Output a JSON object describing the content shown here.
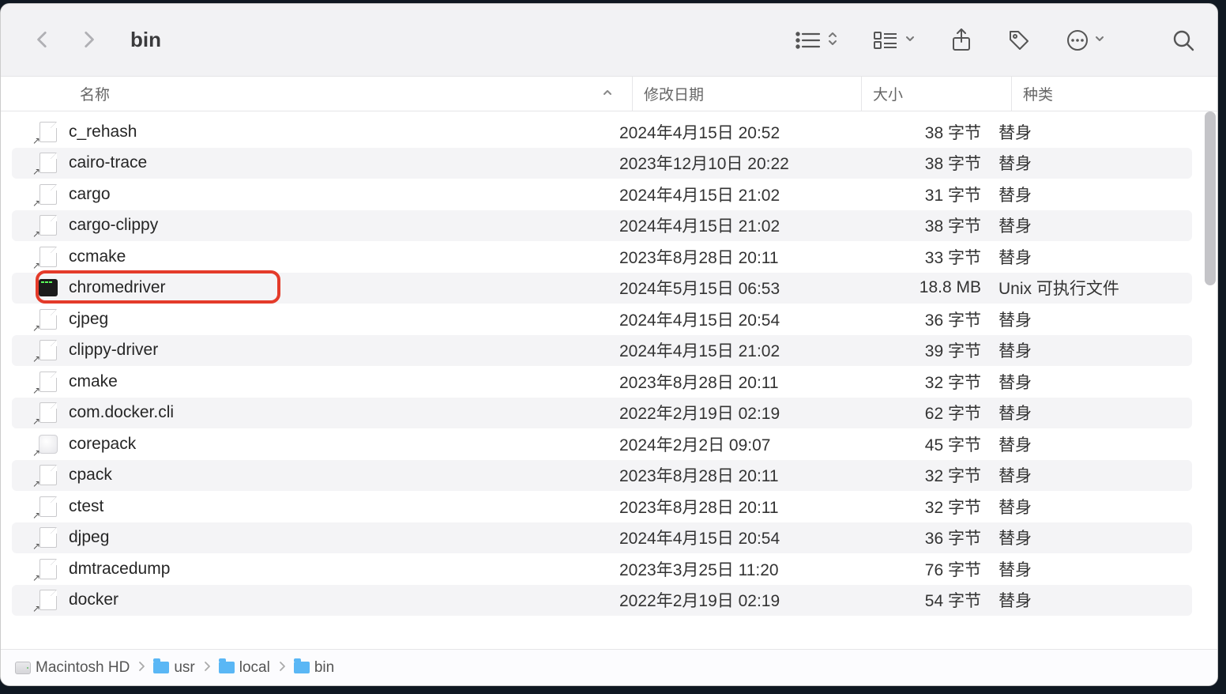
{
  "toolbar": {
    "title": "bin"
  },
  "columns": {
    "name": "名称",
    "date": "修改日期",
    "size": "大小",
    "kind": "种类"
  },
  "files": [
    {
      "name": "c_rehash",
      "date": "2024年4月15日 20:52",
      "size": "38 字节",
      "kind": "替身",
      "icon": "alias"
    },
    {
      "name": "cairo-trace",
      "date": "2023年12月10日 20:22",
      "size": "38 字节",
      "kind": "替身",
      "icon": "alias"
    },
    {
      "name": "cargo",
      "date": "2024年4月15日 21:02",
      "size": "31 字节",
      "kind": "替身",
      "icon": "alias"
    },
    {
      "name": "cargo-clippy",
      "date": "2024年4月15日 21:02",
      "size": "38 字节",
      "kind": "替身",
      "icon": "alias"
    },
    {
      "name": "ccmake",
      "date": "2023年8月28日 20:11",
      "size": "33 字节",
      "kind": "替身",
      "icon": "alias"
    },
    {
      "name": "chromedriver",
      "date": "2024年5月15日 06:53",
      "size": "18.8 MB",
      "kind": "Unix 可执行文件",
      "icon": "exec",
      "highlighted": true
    },
    {
      "name": "cjpeg",
      "date": "2024年4月15日 20:54",
      "size": "36 字节",
      "kind": "替身",
      "icon": "alias"
    },
    {
      "name": "clippy-driver",
      "date": "2024年4月15日 21:02",
      "size": "39 字节",
      "kind": "替身",
      "icon": "alias"
    },
    {
      "name": "cmake",
      "date": "2023年8月28日 20:11",
      "size": "32 字节",
      "kind": "替身",
      "icon": "alias"
    },
    {
      "name": "com.docker.cli",
      "date": "2022年2月19日 02:19",
      "size": "62 字节",
      "kind": "替身",
      "icon": "alias"
    },
    {
      "name": "corepack",
      "date": "2024年2月2日 09:07",
      "size": "45 字节",
      "kind": "替身",
      "icon": "shell"
    },
    {
      "name": "cpack",
      "date": "2023年8月28日 20:11",
      "size": "32 字节",
      "kind": "替身",
      "icon": "alias"
    },
    {
      "name": "ctest",
      "date": "2023年8月28日 20:11",
      "size": "32 字节",
      "kind": "替身",
      "icon": "alias"
    },
    {
      "name": "djpeg",
      "date": "2024年4月15日 20:54",
      "size": "36 字节",
      "kind": "替身",
      "icon": "alias"
    },
    {
      "name": "dmtracedump",
      "date": "2023年3月25日 11:20",
      "size": "76 字节",
      "kind": "替身",
      "icon": "alias"
    },
    {
      "name": "docker",
      "date": "2022年2月19日 02:19",
      "size": "54 字节",
      "kind": "替身",
      "icon": "alias"
    }
  ],
  "path": [
    {
      "label": "Macintosh HD",
      "icon": "hd"
    },
    {
      "label": "usr",
      "icon": "folder"
    },
    {
      "label": "local",
      "icon": "folder"
    },
    {
      "label": "bin",
      "icon": "folder"
    }
  ]
}
